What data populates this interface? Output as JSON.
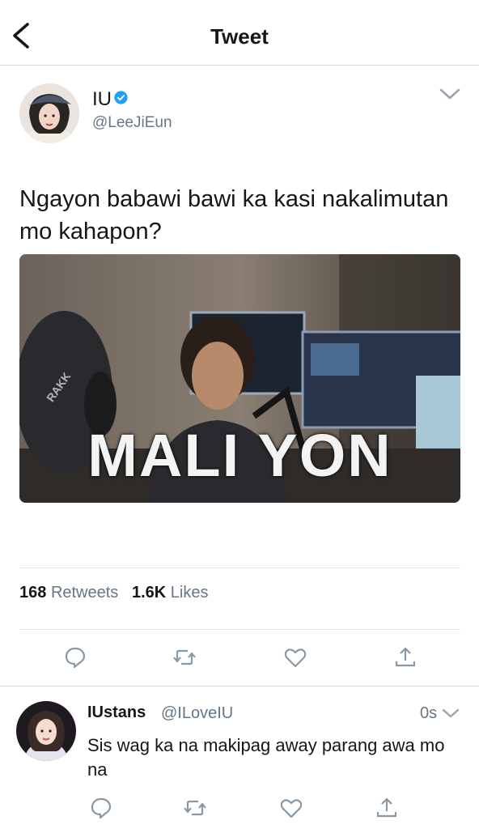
{
  "header": {
    "title": "Tweet"
  },
  "tweet": {
    "author_name": "IU",
    "author_handle": "@LeeJiEun",
    "verified": true,
    "text": "Ngayon babawi bawi ka kasi nakalimutan mo kahapon?",
    "media": {
      "caption": "MALI YON",
      "visible_logo_text": "RAKK"
    },
    "stats": {
      "retweets_count": "168",
      "retweets_label": "Retweets",
      "likes_count": "1.6K",
      "likes_label": "Likes"
    },
    "actions": [
      "reply-icon",
      "retweet-icon",
      "like-icon",
      "share-icon"
    ]
  },
  "reply": {
    "author_name": "IUstans",
    "author_handle": "@ILoveIU",
    "time": "0s",
    "text": "Sis wag ka na makipag away parang awa mo na",
    "actions": [
      "reply-icon",
      "retweet-icon",
      "like-icon",
      "share-icon"
    ]
  },
  "colors": {
    "verified_blue": "#1da1f2",
    "secondary_text": "#657786",
    "primary_text": "#14171a",
    "divider": "#e1e8ed"
  }
}
